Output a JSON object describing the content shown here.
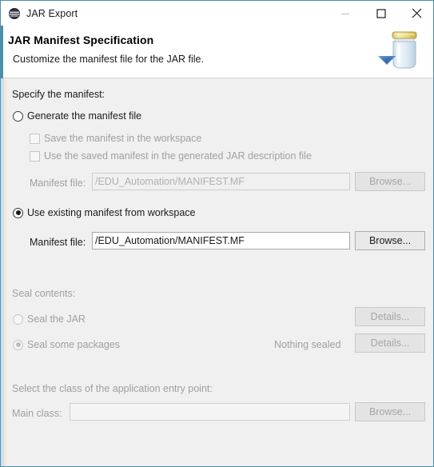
{
  "window": {
    "title": "JAR Export",
    "icon": "eclipse-logo-icon",
    "controls": {
      "minimize": "minimize-icon",
      "maximize": "maximize-icon",
      "close": "close-icon"
    }
  },
  "header": {
    "title": "JAR Manifest Specification",
    "subtitle": "Customize the manifest file for the JAR file.",
    "image": "jar-export-banner-icon"
  },
  "manifest_section": {
    "group_label": "Specify the manifest:",
    "generate_radio": {
      "label": "Generate the manifest file",
      "selected": false,
      "enabled": true
    },
    "save_checkbox": {
      "label": "Save the manifest in the workspace",
      "checked": false,
      "enabled": false
    },
    "use_saved_checkbox": {
      "label": "Use the saved manifest in the generated JAR description file",
      "checked": false,
      "enabled": false
    },
    "generate_manifest_file": {
      "label": "Manifest file:",
      "value": "/EDU_Automation/MANIFEST.MF",
      "placeholder": "",
      "enabled": false,
      "browse_label": "Browse...",
      "browse_enabled": false
    },
    "existing_radio": {
      "label": "Use existing manifest from workspace",
      "selected": true,
      "enabled": true
    },
    "existing_manifest_file": {
      "label": "Manifest file:",
      "value": "/EDU_Automation/MANIFEST.MF",
      "placeholder": "",
      "enabled": true,
      "browse_label": "Browse...",
      "browse_enabled": true
    }
  },
  "seal_section": {
    "group_label": "Seal contents:",
    "seal_jar_radio": {
      "label": "Seal the JAR",
      "selected": false,
      "enabled": false
    },
    "seal_jar_details": {
      "label": "Details...",
      "enabled": false
    },
    "seal_packages_radio": {
      "label": "Seal some packages",
      "selected": true,
      "enabled": false
    },
    "seal_status": "Nothing sealed",
    "seal_packages_details": {
      "label": "Details...",
      "enabled": false
    }
  },
  "entry_point_section": {
    "group_label": "Select the class of the application entry point:",
    "main_class": {
      "label": "Main class:",
      "value": "",
      "placeholder": "",
      "enabled": false,
      "browse_label": "Browse...",
      "browse_enabled": false
    }
  },
  "colors": {
    "accent": "#4a90ab",
    "body_bg": "#f0f0f0",
    "header_bg": "#ffffff",
    "disabled_text": "#a0a0a0",
    "jar_lid": "#e8d27a"
  }
}
